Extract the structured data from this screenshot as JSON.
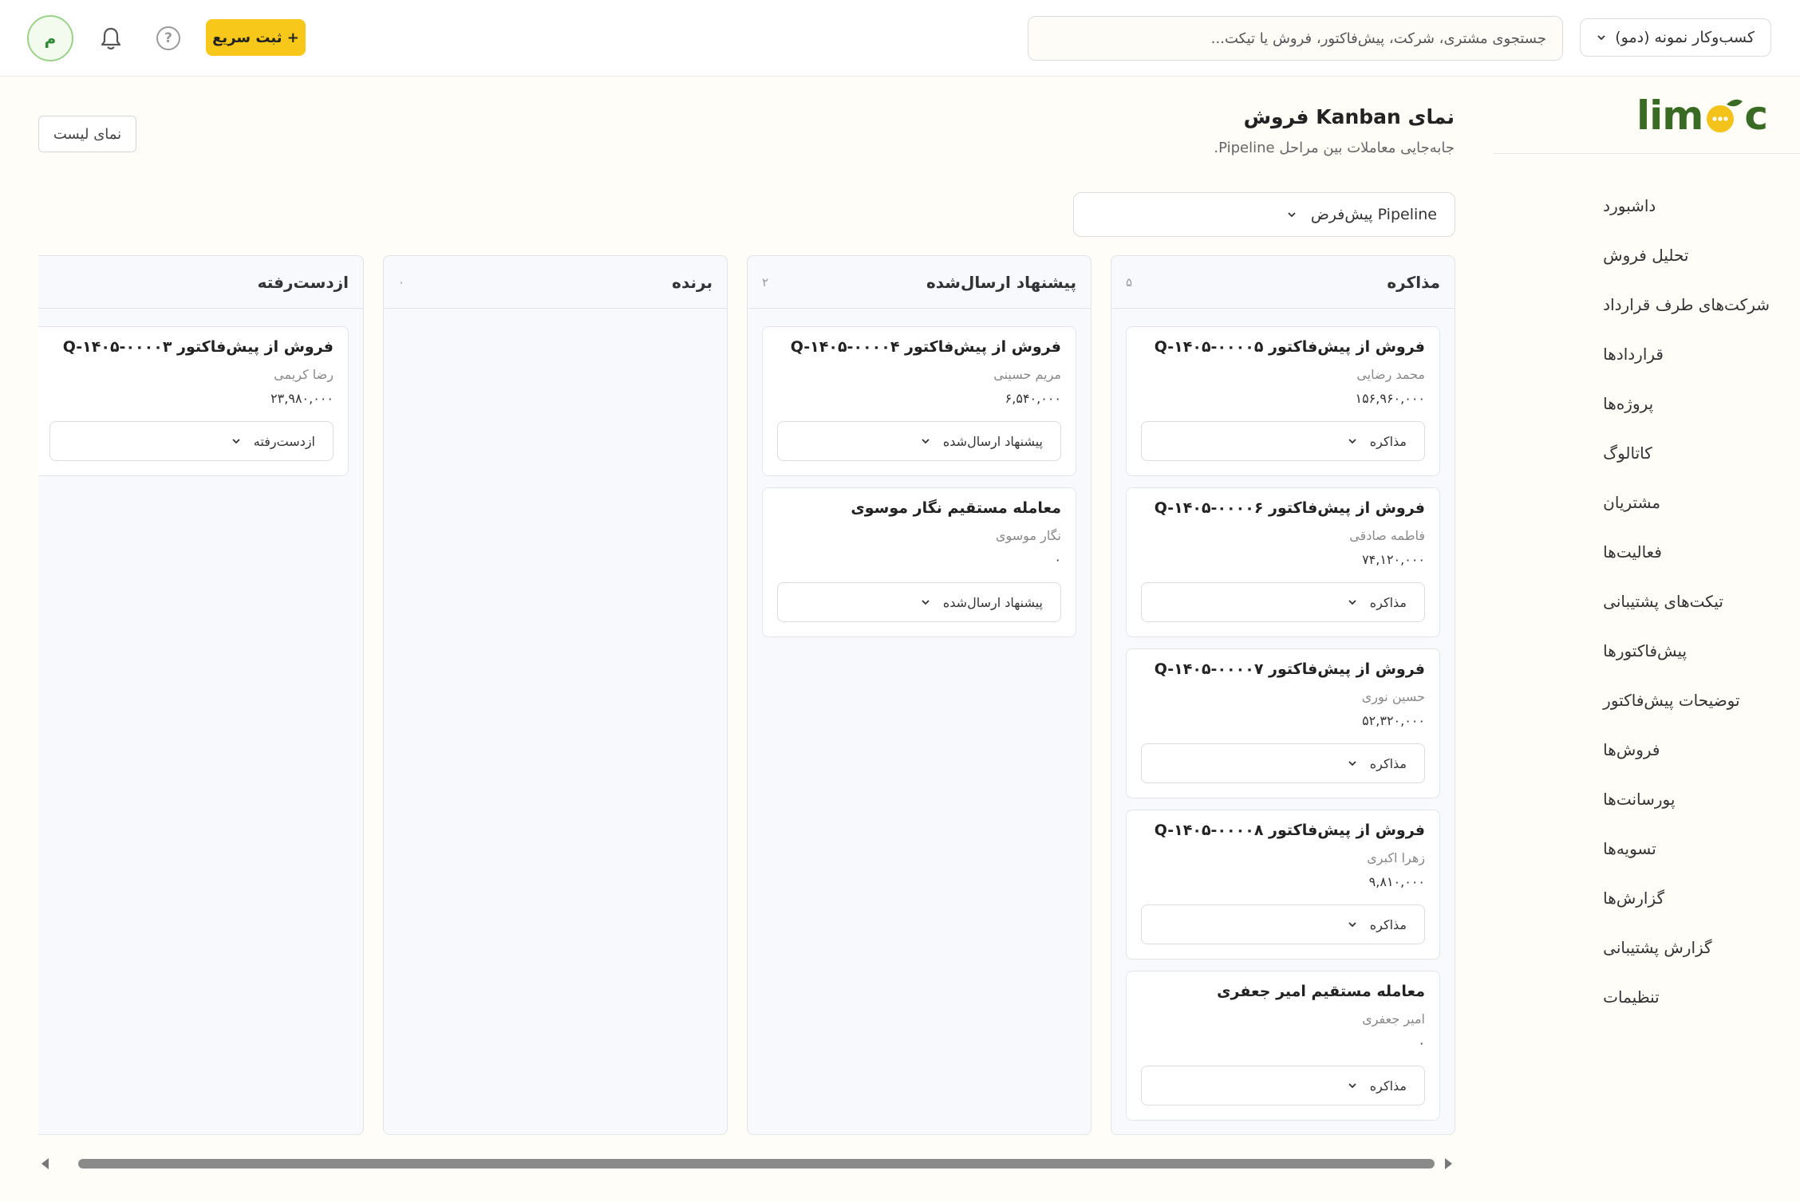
{
  "header": {
    "business_select": "کسب‌وکار نمونه (دمو)",
    "search_placeholder": "جستجوی مشتری، شرکت، پیش‌فاکتور، فروش یا تیکت...",
    "quick_add_label": "+ ثبت سریع",
    "help_icon": "?",
    "avatar_initial": "م"
  },
  "logo": {
    "text": "lim",
    "mark": "c"
  },
  "sidebar": {
    "items": [
      {
        "label": "داشبورد"
      },
      {
        "label": "تحلیل فروش"
      },
      {
        "label": "شرکت‌های طرف قرارداد"
      },
      {
        "label": "قراردادها"
      },
      {
        "label": "پروژه‌ها"
      },
      {
        "label": "کاتالوگ"
      },
      {
        "label": "مشتریان"
      },
      {
        "label": "فعالیت‌ها"
      },
      {
        "label": "تیکت‌های پشتیبانی"
      },
      {
        "label": "پیش‌فاکتورها"
      },
      {
        "label": "توضیحات پیش‌فاکتور"
      },
      {
        "label": "فروش‌ها"
      },
      {
        "label": "پورسانت‌ها"
      },
      {
        "label": "تسویه‌ها"
      },
      {
        "label": "گزارش‌ها"
      },
      {
        "label": "گزارش پشتیبانی"
      },
      {
        "label": "تنظیمات"
      }
    ]
  },
  "page": {
    "title": "نمای Kanban فروش",
    "subtitle": "جابه‌جایی معاملات بین مراحل Pipeline.",
    "list_view_label": "نمای لیست",
    "pipeline_select": "Pipeline پیش‌فرض"
  },
  "columns": [
    {
      "title": "مذاکره",
      "count": "۵",
      "cards": [
        {
          "title": "فروش از پیش‌فاکتور Q-۱۴۰۵-۰۰۰۰۵",
          "person": "محمد رضایی",
          "amount": "۱۵۶,۹۶۰,۰۰۰",
          "stage": "مذاکره"
        },
        {
          "title": "فروش از پیش‌فاکتور Q-۱۴۰۵-۰۰۰۰۶",
          "person": "فاطمه صادقی",
          "amount": "۷۴,۱۲۰,۰۰۰",
          "stage": "مذاکره"
        },
        {
          "title": "فروش از پیش‌فاکتور Q-۱۴۰۵-۰۰۰۰۷",
          "person": "حسین نوری",
          "amount": "۵۲,۳۲۰,۰۰۰",
          "stage": "مذاکره"
        },
        {
          "title": "فروش از پیش‌فاکتور Q-۱۴۰۵-۰۰۰۰۸",
          "person": "زهرا اکبری",
          "amount": "۹,۸۱۰,۰۰۰",
          "stage": "مذاکره"
        },
        {
          "title": "معامله مستقیم امیر جعفری",
          "person": "امیر جعفری",
          "amount": "۰",
          "stage": "مذاکره"
        }
      ]
    },
    {
      "title": "پیشنهاد ارسال‌شده",
      "count": "۲",
      "cards": [
        {
          "title": "فروش از پیش‌فاکتور Q-۱۴۰۵-۰۰۰۰۴",
          "person": "مریم حسینی",
          "amount": "۶,۵۴۰,۰۰۰",
          "stage": "پیشنهاد ارسال‌شده"
        },
        {
          "title": "معامله مستقیم نگار موسوی",
          "person": "نگار موسوی",
          "amount": "۰",
          "stage": "پیشنهاد ارسال‌شده"
        }
      ]
    },
    {
      "title": "برنده",
      "count": "۰",
      "cards": []
    },
    {
      "title": "ازدست‌رفته",
      "count": "",
      "cards": [
        {
          "title": "فروش از پیش‌فاکتور Q-۱۴۰۵-۰۰۰۰۳",
          "person": "رضا کریمی",
          "amount": "۲۳,۹۸۰,۰۰۰",
          "stage": "ازدست‌رفته"
        }
      ]
    }
  ]
}
